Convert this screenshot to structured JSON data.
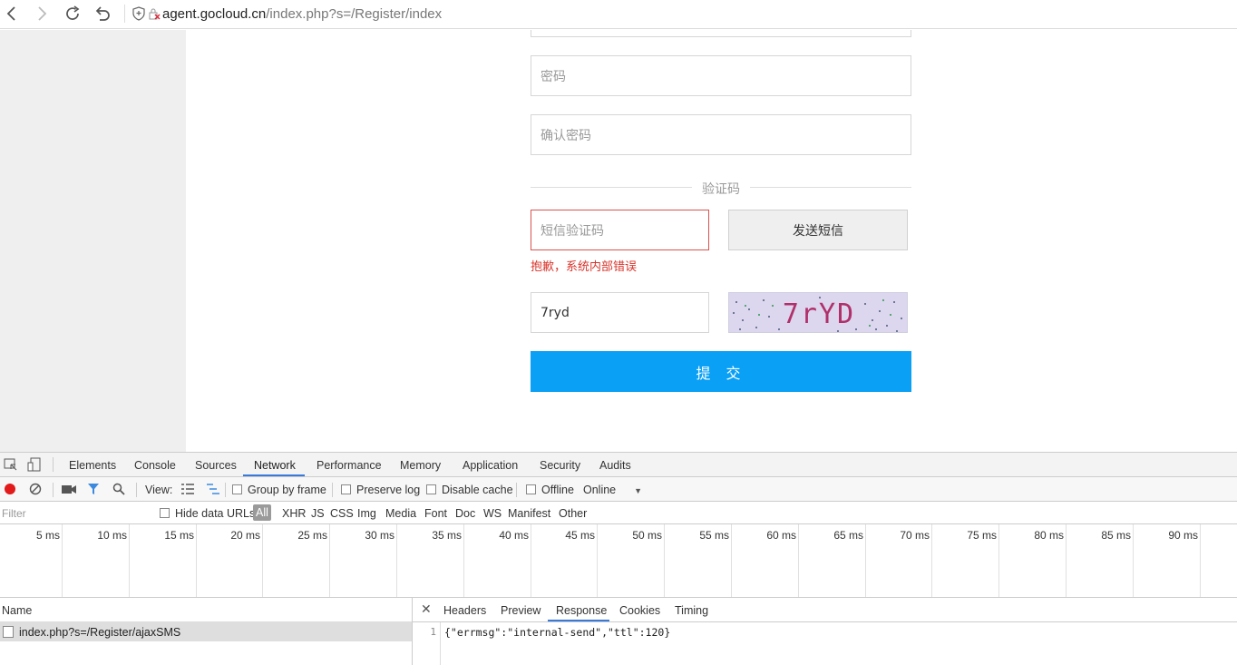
{
  "browser": {
    "url_host": "agent.gocloud.cn",
    "url_path": "/index.php?s=/Register/index"
  },
  "form": {
    "password_placeholder": "密码",
    "confirm_placeholder": "确认密码",
    "divider_label": "验证码",
    "sms_placeholder": "短信验证码",
    "send_sms_label": "发送短信",
    "sms_error": "抱歉，系统内部错误",
    "captcha_value": "7ryd",
    "captcha_image_text": "7rYD",
    "submit_label": "提 交",
    "accent_color": "#0aa0f5",
    "error_color": "#d9342b"
  },
  "devtools": {
    "tabs": [
      "Elements",
      "Console",
      "Sources",
      "Network",
      "Performance",
      "Memory",
      "Application",
      "Security",
      "Audits"
    ],
    "active_tab": "Network",
    "toolbar": {
      "view_label": "View:",
      "group_by_frame": "Group by frame",
      "preserve_log": "Preserve log",
      "disable_cache": "Disable cache",
      "offline": "Offline",
      "throttle_value": "Online"
    },
    "filter": {
      "placeholder": "Filter",
      "hide_data_urls": "Hide data URLs",
      "types": [
        "All",
        "XHR",
        "JS",
        "CSS",
        "Img",
        "Media",
        "Font",
        "Doc",
        "WS",
        "Manifest",
        "Other"
      ],
      "active_type": "All"
    },
    "timeline_ticks": [
      "5 ms",
      "10 ms",
      "15 ms",
      "20 ms",
      "25 ms",
      "30 ms",
      "35 ms",
      "40 ms",
      "45 ms",
      "50 ms",
      "55 ms",
      "60 ms",
      "65 ms",
      "70 ms",
      "75 ms",
      "80 ms",
      "85 ms",
      "90 ms"
    ],
    "requests": {
      "column_name": "Name",
      "rows": [
        "index.php?s=/Register/ajaxSMS"
      ]
    },
    "detail": {
      "tabs": [
        "Headers",
        "Preview",
        "Response",
        "Cookies",
        "Timing"
      ],
      "active_tab": "Response",
      "line_number": "1",
      "response_body": "{\"errmsg\":\"internal-send\",\"ttl\":120}"
    }
  }
}
